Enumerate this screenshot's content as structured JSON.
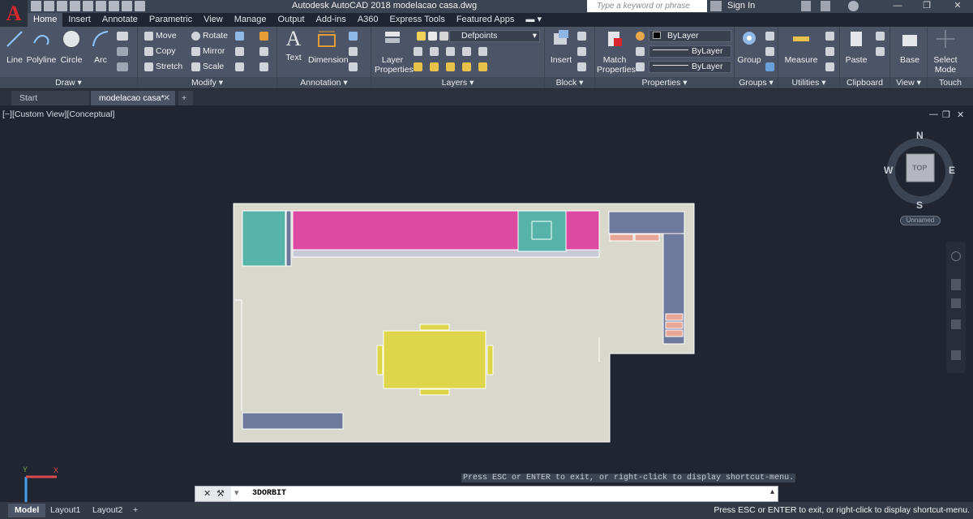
{
  "titlebar": {
    "app_logo": "A",
    "title": "Autodesk AutoCAD 2018     modelacao casa.dwg",
    "search_placeholder": "Type a keyword or phrase",
    "sign_in": "Sign In",
    "minimize": "—",
    "restore": "❐",
    "close": "✕"
  },
  "ribbon_tabs": [
    "Home",
    "Insert",
    "Annotate",
    "Parametric",
    "View",
    "Manage",
    "Output",
    "Add-ins",
    "A360",
    "Express Tools",
    "Featured Apps"
  ],
  "ribbon": {
    "draw": {
      "title": "Draw ▾",
      "line": "Line",
      "polyline": "Polyline",
      "circle": "Circle",
      "arc": "Arc"
    },
    "modify": {
      "title": "Modify ▾",
      "move": "Move",
      "rotate": "Rotate",
      "copy": "Copy",
      "mirror": "Mirror",
      "stretch": "Stretch",
      "scale": "Scale"
    },
    "annotation": {
      "title": "Annotation ▾",
      "text": "Text",
      "dimension": "Dimension"
    },
    "layers": {
      "title": "Layers ▾",
      "layer_properties": "Layer Properties",
      "current_layer": "Defpoints"
    },
    "block": {
      "title": "Block ▾",
      "insert": "Insert"
    },
    "properties": {
      "title": "Properties ▾",
      "match_properties": "Match Properties",
      "color": "ByLayer",
      "linetype": "ByLayer",
      "lineweight": "ByLayer"
    },
    "groups": {
      "title": "Groups ▾",
      "group": "Group"
    },
    "utilities": {
      "title": "Utilities ▾",
      "measure": "Measure"
    },
    "clipboard": {
      "title": "Clipboard",
      "paste": "Paste"
    },
    "view": {
      "title": "View ▾",
      "base": "Base"
    },
    "touch": {
      "title": "Touch",
      "select_mode": "Select Mode"
    }
  },
  "doc_tabs": {
    "start": "Start",
    "current": "modelacao casa*",
    "close": "✕",
    "new": "+"
  },
  "viewport": {
    "label": "[−][Custom View][Conceptual]",
    "min": "—",
    "restore": "❐",
    "close": "✕"
  },
  "viewcube": {
    "n": "N",
    "s": "S",
    "e": "E",
    "w": "W",
    "face": "TOP",
    "wcs": "Unnamed"
  },
  "command": {
    "tooltip": "Press ESC or ENTER to exit, or right-click to display shortcut-menu.",
    "current": "3DORBIT"
  },
  "statusbar": {
    "layouts": [
      "Model",
      "Layout1",
      "Layout2"
    ],
    "add": "+",
    "message": "Press ESC or ENTER to exit, or right-click to display shortcut-menu."
  },
  "colors": {
    "floor": "#d9d8cc",
    "cabinet_pink": "#dd4aa2",
    "teal": "#57b3a9",
    "slate": "#6d7a9b",
    "table_yellow": "#ddd54a",
    "salmon": "#e7a696"
  }
}
